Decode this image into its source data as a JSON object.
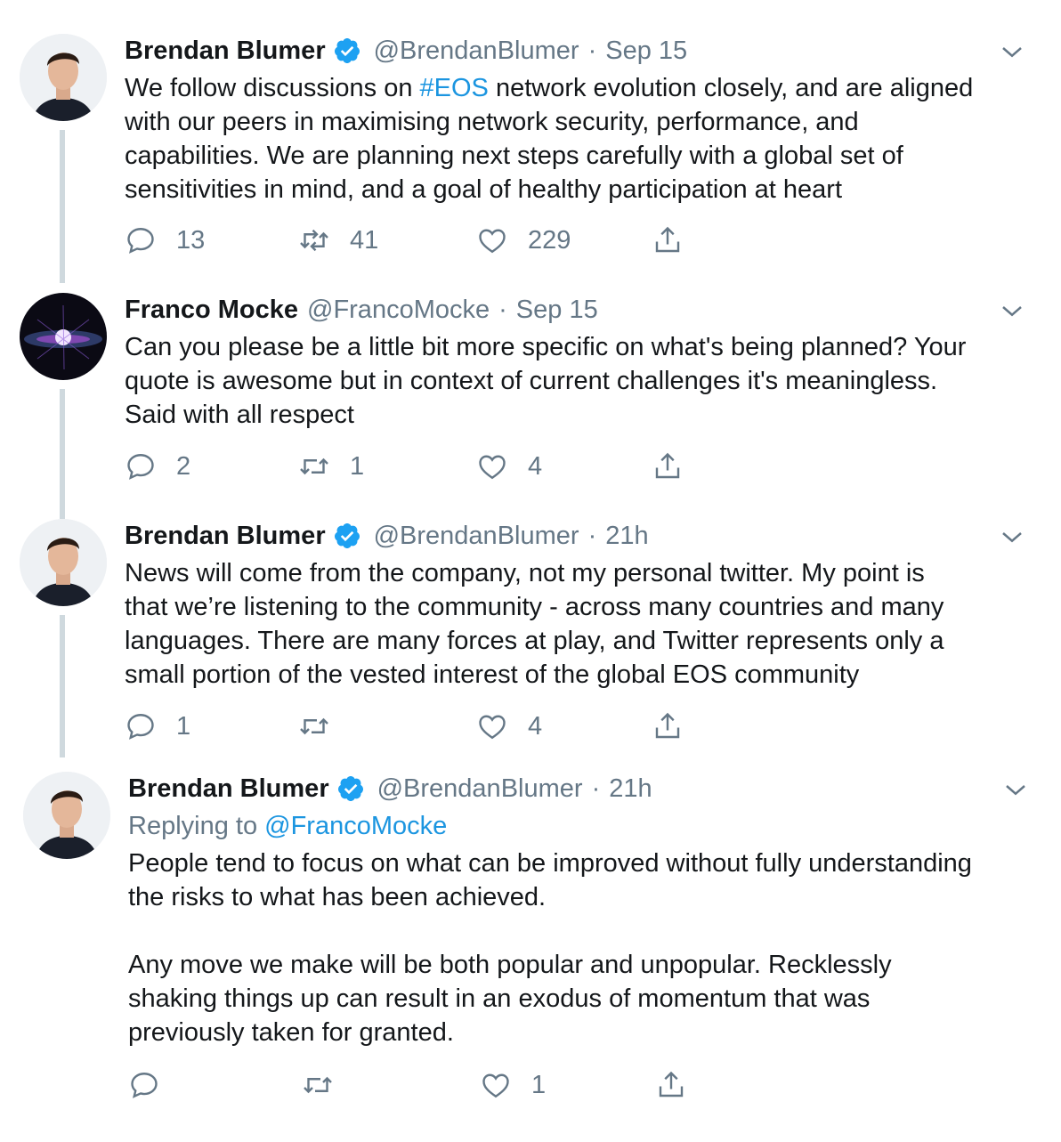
{
  "tweets": [
    {
      "name": "Brendan Blumer",
      "verified": true,
      "handle": "@BrendanBlumer",
      "separator": "·",
      "time": "Sep 15",
      "text_before": "We follow discussions on ",
      "hashtag": "#EOS",
      "text_after": " network evolution closely, and are aligned\nwith our peers in maximising network security, performance, and\ncapabilities. We are planning next steps carefully with a global set of\nsensitivities in mind, and a goal of healthy participation at heart",
      "replies": "13",
      "retweets": "41",
      "likes": "229"
    },
    {
      "name": "Franco Mocke",
      "verified": false,
      "handle": "@FrancoMocke",
      "separator": "·",
      "time": "Sep 15",
      "text": "Can you please be a little bit more specific on what's being planned? Your\nquote is awesome but in context of current challenges it's meaningless.\nSaid with all respect",
      "replies": "2",
      "retweets": "1",
      "likes": "4"
    },
    {
      "name": "Brendan Blumer",
      "verified": true,
      "handle": "@BrendanBlumer",
      "separator": "·",
      "time": "21h",
      "text": "News will come from the company, not my personal twitter. My point is\nthat we’re listening to the community - across many countries and many\nlanguages. There are many forces at play, and Twitter represents only a\nsmall portion of the vested interest of the global EOS community",
      "replies": "1",
      "retweets": "",
      "likes": "4"
    },
    {
      "name": "Brendan Blumer",
      "verified": true,
      "handle": "@BrendanBlumer",
      "separator": "·",
      "time": "21h",
      "replying_label": "Replying to ",
      "replying_to": "@FrancoMocke",
      "text": "People tend to focus on what can be improved without fully understanding\nthe risks to what has been achieved.\n\nAny move we make will be both popular and unpopular. Recklessly\nshaking things up can result in an exodus of momentum that was\npreviously taken for granted.",
      "replies": "",
      "retweets": "",
      "likes": "1"
    }
  ],
  "colors": {
    "text": "#14171a",
    "secondary": "#657786",
    "link": "#1b95e0",
    "verified": "#1da1f2",
    "thread_line": "#cfd9de"
  },
  "icons": [
    "reply-icon",
    "retweet-icon",
    "like-icon",
    "share-icon",
    "verified-badge-icon",
    "chevron-down-icon"
  ]
}
